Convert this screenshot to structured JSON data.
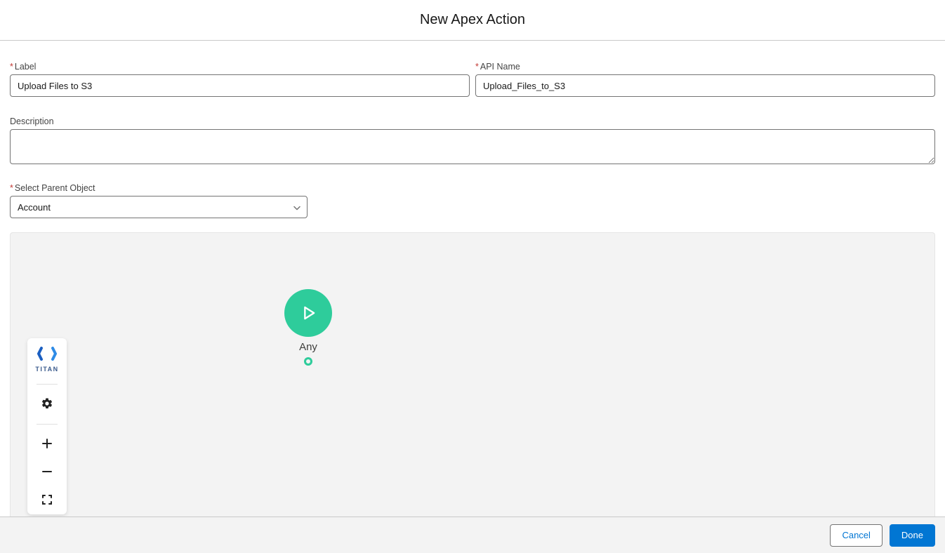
{
  "header": {
    "title": "New Apex Action"
  },
  "fields": {
    "label_label": "Label",
    "label_value": "Upload Files to S3",
    "api_name_label": "API Name",
    "api_name_value": "Upload_Files_to_S3",
    "description_label": "Description",
    "description_value": "",
    "parent_object_label": "Select Parent Object",
    "parent_object_value": "Account"
  },
  "canvas": {
    "start_node_label": "Any",
    "toolbar": {
      "brand": "TITAN"
    }
  },
  "footer": {
    "cancel": "Cancel",
    "done": "Done"
  }
}
